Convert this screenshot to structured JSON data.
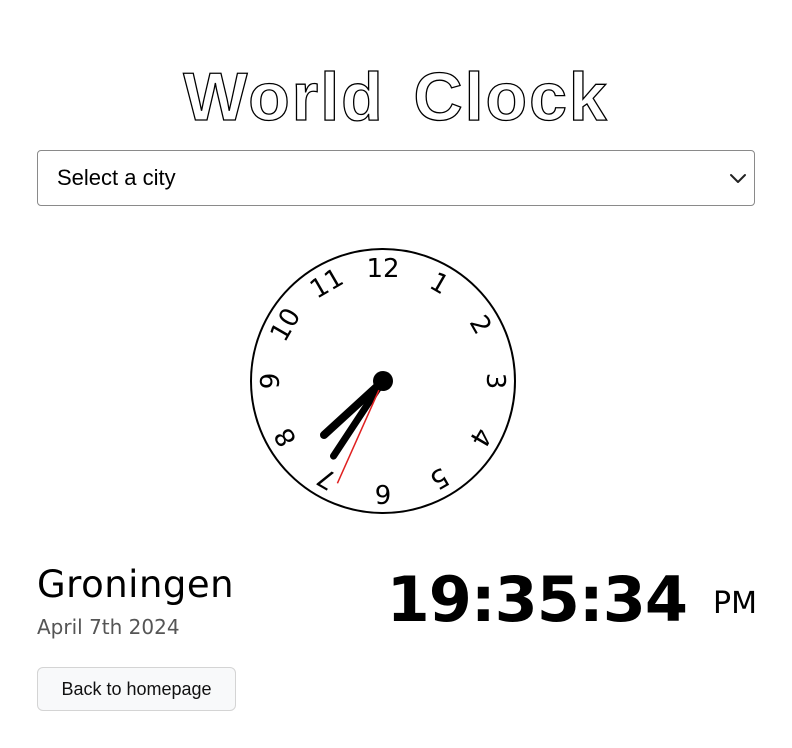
{
  "header": {
    "title_word1": "World",
    "title_word2": "Clock"
  },
  "city_select": {
    "placeholder": "Select a city",
    "chevron_icon": "chevron-down-icon"
  },
  "clock": {
    "numerals": [
      "12",
      "1",
      "2",
      "3",
      "4",
      "5",
      "6",
      "7",
      "8",
      "9",
      "10",
      "11"
    ],
    "hour": 7,
    "minute": 35,
    "second": 34,
    "hand_color": "#000000",
    "second_hand_color": "#e02020"
  },
  "location": {
    "city": "Groningen",
    "date": "April 7th 2024"
  },
  "time": {
    "digital": "19:35:34",
    "period": "PM"
  },
  "actions": {
    "back_label": "Back to homepage"
  }
}
